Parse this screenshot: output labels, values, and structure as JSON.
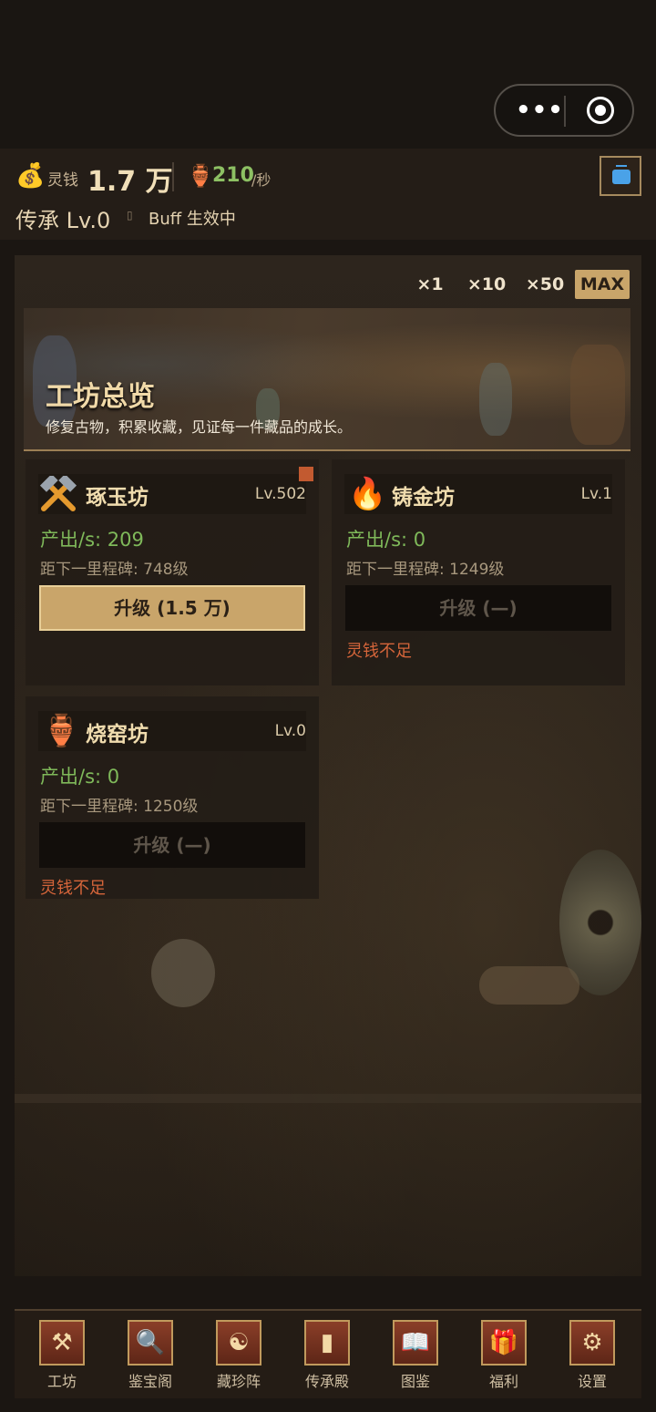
{
  "top": {
    "menu_dots": "•••"
  },
  "status": {
    "currency_label": "灵钱",
    "currency_value": "1.7 万",
    "rate_value": "210",
    "rate_unit": "/秒",
    "inherit": "传承 Lv.0",
    "buff": "Buff 生效中"
  },
  "multipliers": [
    "×1",
    "×10",
    "×50",
    "MAX"
  ],
  "multiplier_selected": "MAX",
  "banner": {
    "title": "工坊总览",
    "subtitle": "修复古物，积累收藏，见证每一件藏品的成长。"
  },
  "workshops": [
    {
      "name": "琢玉坊",
      "icon": "hammer-icon",
      "level": "Lv.502",
      "output": "产出/s: 209",
      "milestone": "距下一里程碑: 748级",
      "button": "升级 (1.5 万)",
      "enabled": true,
      "warning": "",
      "badge": true
    },
    {
      "name": "铸金坊",
      "icon": "fire-icon",
      "level": "Lv.1",
      "output": "产出/s: 0",
      "milestone": "距下一里程碑: 1249级",
      "button": "升级 (—)",
      "enabled": false,
      "warning": "灵钱不足",
      "badge": false
    },
    {
      "name": "烧窑坊",
      "icon": "amphora-icon",
      "level": "Lv.0",
      "output": "产出/s: 0",
      "milestone": "距下一里程碑: 1250级",
      "button": "升级 (—)",
      "enabled": false,
      "warning": "灵钱不足",
      "badge": false
    }
  ],
  "nav": [
    {
      "label": "工坊",
      "icon": "anvil-icon"
    },
    {
      "label": "鉴宝阁",
      "icon": "magnifier-jar-icon"
    },
    {
      "label": "藏珍阵",
      "icon": "bagua-icon"
    },
    {
      "label": "传承殿",
      "icon": "stele-icon"
    },
    {
      "label": "图鉴",
      "icon": "book-icon"
    },
    {
      "label": "福利",
      "icon": "chest-icon"
    },
    {
      "label": "设置",
      "icon": "gear-icon"
    }
  ],
  "colors": {
    "accent": "#c9a56a",
    "output_green": "#7fb95a",
    "warning": "#d5653a",
    "rate_green": "#8dc063"
  }
}
